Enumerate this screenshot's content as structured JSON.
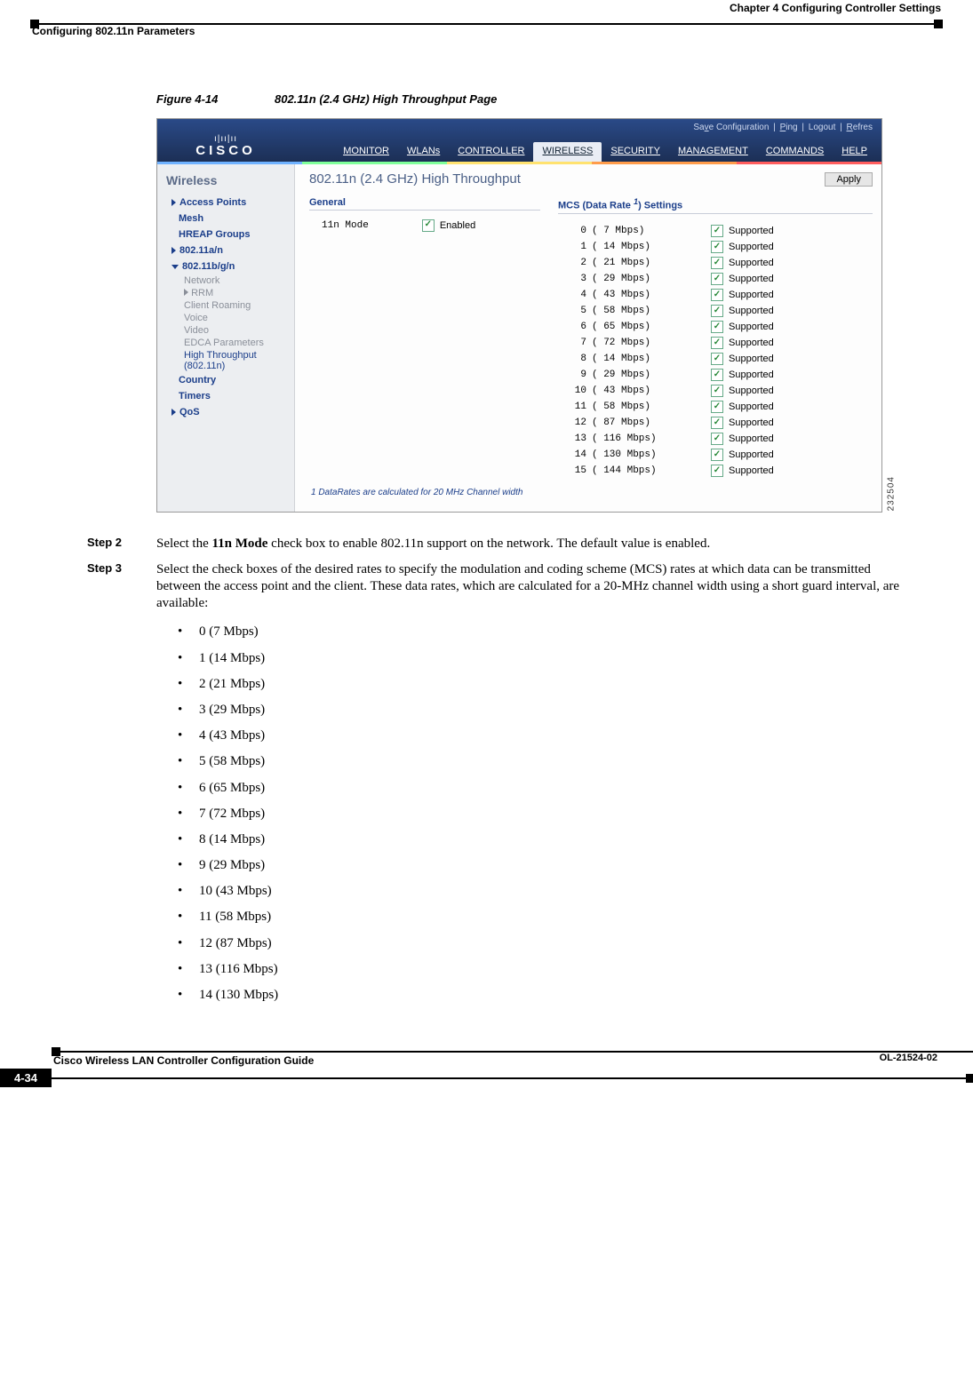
{
  "header": {
    "chapter": "Chapter 4      Configuring Controller Settings",
    "section": "Configuring 802.11n Parameters"
  },
  "figure": {
    "label": "Figure 4-14",
    "title": "802.11n (2.4 GHz) High Throughput Page"
  },
  "shot": {
    "logo": "CISCO",
    "toplinks": {
      "save": "Save Configuration",
      "ping": "Ping",
      "logout": "Logout",
      "refresh": "Refres"
    },
    "tabs": [
      "MONITOR",
      "WLANs",
      "CONTROLLER",
      "WIRELESS",
      "SECURITY",
      "MANAGEMENT",
      "COMMANDS",
      "HELP"
    ],
    "active_tab_index": 3,
    "sidebar_title": "Wireless",
    "sidebar": {
      "g_ap": "Access Points",
      "g_mesh": "Mesh",
      "g_hreap": "HREAP Groups",
      "g_80211an": "802.11a/n",
      "g_80211bgn": "802.11b/g/n",
      "s_network": "Network",
      "s_rrm": "RRM",
      "s_roaming": "Client Roaming",
      "s_voice": "Voice",
      "s_video": "Video",
      "s_edca": "EDCA Parameters",
      "s_ht": "High Throughput (802.11n)",
      "g_country": "Country",
      "g_timers": "Timers",
      "g_qos": "QoS"
    },
    "page_title": "802.11n (2.4 GHz) High Throughput",
    "apply": "Apply",
    "general_head": "General",
    "mode_label": "11n Mode",
    "enabled_label": "Enabled",
    "mcs_head_a": "MCS (Data Rate ",
    "mcs_head_b": ") Settings",
    "mcs_sup": "1",
    "supported_label": "Supported",
    "mcs": [
      {
        "idx": "0",
        "rate": "( 7   Mbps)"
      },
      {
        "idx": "1",
        "rate": "( 14  Mbps)"
      },
      {
        "idx": "2",
        "rate": "( 21  Mbps)"
      },
      {
        "idx": "3",
        "rate": "( 29  Mbps)"
      },
      {
        "idx": "4",
        "rate": "( 43  Mbps)"
      },
      {
        "idx": "5",
        "rate": "( 58  Mbps)"
      },
      {
        "idx": "6",
        "rate": "( 65  Mbps)"
      },
      {
        "idx": "7",
        "rate": "( 72  Mbps)"
      },
      {
        "idx": "8",
        "rate": "( 14  Mbps)"
      },
      {
        "idx": "9",
        "rate": "( 29  Mbps)"
      },
      {
        "idx": "10",
        "rate": "( 43  Mbps)"
      },
      {
        "idx": "11",
        "rate": "( 58  Mbps)"
      },
      {
        "idx": "12",
        "rate": "( 87  Mbps)"
      },
      {
        "idx": "13",
        "rate": "( 116 Mbps)"
      },
      {
        "idx": "14",
        "rate": "( 130 Mbps)"
      },
      {
        "idx": "15",
        "rate": "( 144 Mbps)"
      }
    ],
    "footnote": "1 DataRates are calculated for 20 MHz Channel width",
    "img_id": "232504"
  },
  "steps": {
    "s2_label": "Step 2",
    "s2_a": "Select the ",
    "s2_b": "11n Mode",
    "s2_c": " check box to enable 802.11n support on the network. The default value is enabled.",
    "s3_label": "Step 3",
    "s3": "Select the check boxes of the desired rates to specify the modulation and coding scheme (MCS) rates at which data can be transmitted between the access point and the client. These data rates, which are calculated for a 20-MHz channel width using a short guard interval, are available:",
    "bullets": [
      "0 (7 Mbps)",
      "1 (14 Mbps)",
      "2 (21 Mbps)",
      "3 (29 Mbps)",
      "4 (43 Mbps)",
      "5 (58 Mbps)",
      "6 (65 Mbps)",
      "7 (72 Mbps)",
      "8 (14 Mbps)",
      "9 (29 Mbps)",
      "10 (43 Mbps)",
      "11 (58 Mbps)",
      "12 (87 Mbps)",
      "13 (116 Mbps)",
      "14 (130 Mbps)"
    ]
  },
  "footer": {
    "guide": "Cisco Wireless LAN Controller Configuration Guide",
    "page": "4-34",
    "doc": "OL-21524-02"
  }
}
